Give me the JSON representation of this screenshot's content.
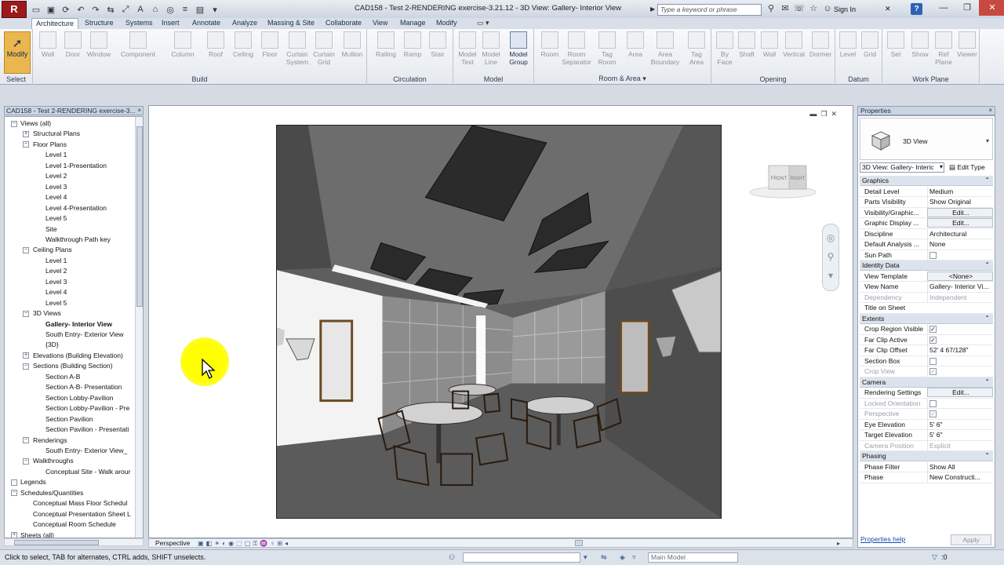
{
  "titlebar": {
    "logo": "R",
    "title": "CAD158 - Test 2-RENDERING exercise-3.21.12 - 3D View: Gallery- Interior View",
    "search_placeholder": "Type a keyword or phrase",
    "sign_in": "Sign In",
    "help": "?"
  },
  "ribbon_tabs": [
    "Architecture",
    "Structure",
    "Systems",
    "Insert",
    "Annotate",
    "Analyze",
    "Massing & Site",
    "Collaborate",
    "View",
    "Manage",
    "Modify"
  ],
  "ribbon": {
    "modify": "Modify",
    "select_panel": "Select",
    "build_panel": "Build",
    "build_buttons": [
      "Wall",
      "Door",
      "Window",
      "Component",
      "Column",
      "Roof",
      "Ceiling",
      "Floor",
      "Curtain System",
      "Curtain Grid",
      "Mullion"
    ],
    "circulation_panel": "Circulation",
    "circulation_buttons": [
      "Railing",
      "Ramp",
      "Stair"
    ],
    "model_panel": "Model",
    "model_buttons": [
      "Model Text",
      "Model Line",
      "Model Group"
    ],
    "room_panel": "Room & Area",
    "room_buttons": [
      "Room",
      "Room Separator",
      "Tag Room",
      "Area",
      "Area Boundary",
      "Tag Area"
    ],
    "opening_panel": "Opening",
    "opening_buttons": [
      "By Face",
      "Shaft",
      "Wall",
      "Vertical",
      "Dormer"
    ],
    "datum_panel": "Datum",
    "datum_buttons": [
      "Level",
      "Grid"
    ],
    "workplane_panel": "Work Plane",
    "workplane_buttons": [
      "Set",
      "Show",
      "Ref Plane",
      "Viewer"
    ]
  },
  "project_browser": {
    "header": "CAD158 - Test 2-RENDERING exercise-3...",
    "close": "×",
    "items": [
      {
        "label": "Views (all)",
        "level": 0,
        "toggle": "−"
      },
      {
        "label": "Structural Plans",
        "level": 1,
        "toggle": "+"
      },
      {
        "label": "Floor Plans",
        "level": 1,
        "toggle": "−"
      },
      {
        "label": "Level 1",
        "level": 2
      },
      {
        "label": "Level 1-Presentation",
        "level": 2
      },
      {
        "label": "Level 2",
        "level": 2
      },
      {
        "label": "Level 3",
        "level": 2
      },
      {
        "label": "Level 4",
        "level": 2
      },
      {
        "label": "Level 4-Presentation",
        "level": 2
      },
      {
        "label": "Level 5",
        "level": 2
      },
      {
        "label": "Site",
        "level": 2
      },
      {
        "label": "Walkthrough Path key",
        "level": 2
      },
      {
        "label": "Ceiling Plans",
        "level": 1,
        "toggle": "−"
      },
      {
        "label": "Level 1",
        "level": 2
      },
      {
        "label": "Level 2",
        "level": 2
      },
      {
        "label": "Level 3",
        "level": 2
      },
      {
        "label": "Level 4",
        "level": 2
      },
      {
        "label": "Level 5",
        "level": 2
      },
      {
        "label": "3D Views",
        "level": 1,
        "toggle": "−"
      },
      {
        "label": "Gallery- Interior View",
        "level": 2,
        "bold": true
      },
      {
        "label": "South Entry- Exterior View",
        "level": 2
      },
      {
        "label": "{3D}",
        "level": 2
      },
      {
        "label": "Elevations (Building Elevation)",
        "level": 1,
        "toggle": "+"
      },
      {
        "label": "Sections (Building Section)",
        "level": 1,
        "toggle": "−"
      },
      {
        "label": "Section A-B",
        "level": 2
      },
      {
        "label": "Section A-B- Presentation",
        "level": 2
      },
      {
        "label": "Section Lobby-Pavilion",
        "level": 2
      },
      {
        "label": "Section Lobby-Pavilion - Pre",
        "level": 2
      },
      {
        "label": "Section Pavilion",
        "level": 2
      },
      {
        "label": "Section Pavilion - Presentati",
        "level": 2
      },
      {
        "label": "Renderings",
        "level": 1,
        "toggle": "−"
      },
      {
        "label": "South Entry- Exterior View_",
        "level": 2
      },
      {
        "label": "Walkthroughs",
        "level": 1,
        "toggle": "−"
      },
      {
        "label": "Conceptual Site - Walk arour",
        "level": 2
      },
      {
        "label": "Legends",
        "level": 0,
        "toggle": "·"
      },
      {
        "label": "Schedules/Quantities",
        "level": 0,
        "toggle": "−"
      },
      {
        "label": "Conceptual Mass Floor Schedul",
        "level": 1
      },
      {
        "label": "Conceptual Presentation Sheet L",
        "level": 1
      },
      {
        "label": "Conceptual Room Schedule",
        "level": 1
      },
      {
        "label": "Sheets (all)",
        "level": 0,
        "toggle": "+"
      }
    ]
  },
  "viewport": {
    "view_bar_label": "Perspective",
    "viewcube_front": "FRONT",
    "viewcube_right": "RIGHT"
  },
  "properties": {
    "header": "Properties",
    "close": "×",
    "type_name": "3D View",
    "instance": "3D View: Gallery- Interic",
    "edit_type": "Edit Type",
    "groups": [
      {
        "name": "Graphics",
        "rows": [
          {
            "name": "Detail Level",
            "value": "Medium"
          },
          {
            "name": "Parts Visibility",
            "value": "Show Original"
          },
          {
            "name": "Visibility/Graphic...",
            "value": "Edit...",
            "button": true
          },
          {
            "name": "Graphic Display ...",
            "value": "Edit...",
            "button": true
          },
          {
            "name": "Discipline",
            "value": "Architectural"
          },
          {
            "name": "Default Analysis ...",
            "value": "None"
          },
          {
            "name": "Sun Path",
            "value": "",
            "check": false
          }
        ]
      },
      {
        "name": "Identity Data",
        "rows": [
          {
            "name": "View Template",
            "value": "<None>",
            "button": true
          },
          {
            "name": "View Name",
            "value": "Gallery- Interior Vi..."
          },
          {
            "name": "Dependency",
            "value": "Independent",
            "disabled": true
          },
          {
            "name": "Title on Sheet",
            "value": ""
          }
        ]
      },
      {
        "name": "Extents",
        "rows": [
          {
            "name": "Crop Region Visible",
            "value": "",
            "check": true
          },
          {
            "name": "Far Clip Active",
            "value": "",
            "check": true
          },
          {
            "name": "Far Clip Offset",
            "value": "52'  4 67/128\""
          },
          {
            "name": "Section Box",
            "value": "",
            "check": false
          },
          {
            "name": "Crop View",
            "value": "",
            "check": true,
            "disabled": true
          }
        ]
      },
      {
        "name": "Camera",
        "rows": [
          {
            "name": "Rendering Settings",
            "value": "Edit...",
            "button": true
          },
          {
            "name": "Locked Orientation",
            "value": "",
            "check": false,
            "disabled": true
          },
          {
            "name": "Perspective",
            "value": "",
            "check": true,
            "disabled": true
          },
          {
            "name": "Eye Elevation",
            "value": "5'  6\""
          },
          {
            "name": "Target Elevation",
            "value": "5'  6\""
          },
          {
            "name": "Camera Position",
            "value": "Explicit",
            "disabled": true
          }
        ]
      },
      {
        "name": "Phasing",
        "rows": [
          {
            "name": "Phase Filter",
            "value": "Show All"
          },
          {
            "name": "Phase",
            "value": "New Constructi..."
          }
        ]
      }
    ],
    "help_link": "Properties help",
    "apply": "Apply"
  },
  "statusbar": {
    "text": "Click to select, TAB for alternates, CTRL adds, SHIFT unselects.",
    "zero": ":0",
    "model": "Main Model"
  }
}
